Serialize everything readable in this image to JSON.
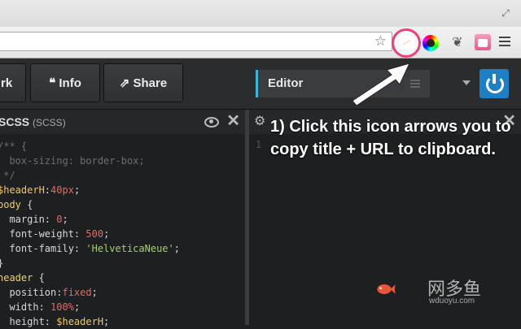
{
  "browser": {
    "icons": [
      "expand-icon",
      "star-icon",
      "copy-title-url-extension-icon",
      "color-picker-extension-icon",
      "evernote-extension-icon",
      "pink-extension-icon",
      "menu-icon"
    ]
  },
  "appbar": {
    "fork_label": "rk",
    "info_label": "Info",
    "share_label": "Share",
    "editor_label": "Editor"
  },
  "left_pane": {
    "lang": "SCSS",
    "lang_sub": "(SCSS)",
    "code_lines": [
      [
        {
          "t": "/** {",
          "c": "c-com"
        }
      ],
      [
        {
          "t": "  box-sizing: border-box;",
          "c": "c-com"
        }
      ],
      [
        {
          "t": " */",
          "c": "c-com"
        }
      ],
      [
        {
          "t": "$headerH",
          "c": "c-var"
        },
        {
          "t": ":",
          "c": "c-key"
        },
        {
          "t": "40px",
          "c": "c-num"
        },
        {
          "t": ";",
          "c": "c-key"
        }
      ],
      [
        {
          "t": "body",
          "c": "c-sel"
        },
        {
          "t": " {",
          "c": "c-key"
        }
      ],
      [
        {
          "t": "  margin",
          "c": "c-key"
        },
        {
          "t": ": ",
          "c": "c-key"
        },
        {
          "t": "0",
          "c": "c-num"
        },
        {
          "t": ";",
          "c": "c-key"
        }
      ],
      [
        {
          "t": "  font-weight",
          "c": "c-key"
        },
        {
          "t": ": ",
          "c": "c-key"
        },
        {
          "t": "500",
          "c": "c-num"
        },
        {
          "t": ";",
          "c": "c-key"
        }
      ],
      [
        {
          "t": "  font-family",
          "c": "c-key"
        },
        {
          "t": ": ",
          "c": "c-key"
        },
        {
          "t": "'HelveticaNeue'",
          "c": "c-str"
        },
        {
          "t": ";",
          "c": "c-key"
        }
      ],
      [
        {
          "t": "}",
          "c": "c-key"
        }
      ],
      [
        {
          "t": "header",
          "c": "c-sel"
        },
        {
          "t": " {",
          "c": "c-key"
        }
      ],
      [
        {
          "t": "  position",
          "c": "c-key"
        },
        {
          "t": ":",
          "c": "c-key"
        },
        {
          "t": "fixed",
          "c": "c-num"
        },
        {
          "t": ";",
          "c": "c-key"
        }
      ],
      [
        {
          "t": "  width",
          "c": "c-key"
        },
        {
          "t": ": ",
          "c": "c-key"
        },
        {
          "t": "100%",
          "c": "c-num"
        },
        {
          "t": ";",
          "c": "c-key"
        }
      ],
      [
        {
          "t": "  height",
          "c": "c-key"
        },
        {
          "t": ": ",
          "c": "c-key"
        },
        {
          "t": "$headerH",
          "c": "c-var"
        },
        {
          "t": ";",
          "c": "c-key"
        }
      ]
    ]
  },
  "right_pane": {
    "line_number": "1",
    "annotation": "1) Click this icon arrows you to copy title + URL to clipboard."
  },
  "watermark": {
    "text": "网多鱼",
    "sub": "wduoyu.com"
  },
  "colors": {
    "highlight_circle": "#e6447a",
    "editor_accent": "#39b8d8",
    "power_button": "#1f7fc4",
    "watermark_fish": "#e8553a"
  }
}
